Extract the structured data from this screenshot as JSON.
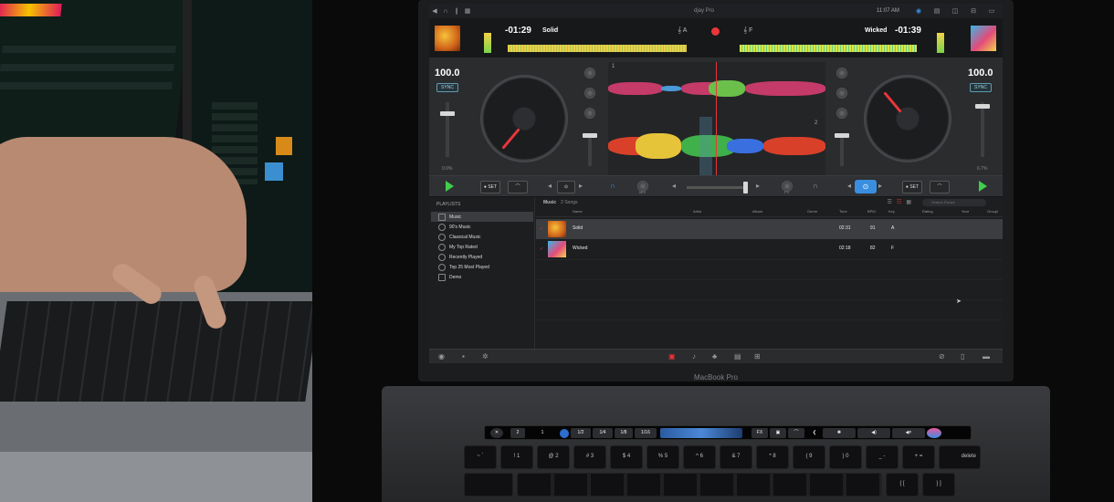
{
  "brand": {
    "laptop_model": "MacBook Pro",
    "app_logo": "djay Pro"
  },
  "menubar": {
    "time": "11:07 AM"
  },
  "deck_left": {
    "time": "-01:29",
    "title": "Solid",
    "key": "A",
    "bpm": "100.0",
    "sync_label": "SYNC",
    "pitch": "0.0%",
    "wave_num": "1"
  },
  "deck_right": {
    "time": "-01:39",
    "title": "Wicked",
    "key": "F",
    "bpm": "100.0",
    "sync_label": "SYNC",
    "pitch": "6.7%",
    "wave_num": "2"
  },
  "transport": {
    "set_label_left": "SET",
    "set_label_right": "SET",
    "label_mix": "MIX",
    "label_fx": "FX"
  },
  "library": {
    "sidebar_title": "PLAYLISTS",
    "playlists": [
      {
        "label": "Music",
        "icon": "music-library-icon",
        "selected": true
      },
      {
        "label": "90's Music",
        "icon": "playlist-icon",
        "selected": false
      },
      {
        "label": "Classical Music",
        "icon": "playlist-icon",
        "selected": false
      },
      {
        "label": "My Top Rated",
        "icon": "playlist-icon",
        "selected": false
      },
      {
        "label": "Recently Played",
        "icon": "playlist-icon",
        "selected": false
      },
      {
        "label": "Top 25 Most Played",
        "icon": "playlist-icon",
        "selected": false
      },
      {
        "label": "Demo",
        "icon": "playlist-folder-icon",
        "selected": false
      }
    ],
    "header_title": "Music",
    "header_count": "2 Songs",
    "search_placeholder": "Search iTunes",
    "columns": [
      "Name",
      "Artist",
      "Album",
      "Genre",
      "Time",
      "BPM",
      "Key",
      "Rating",
      "Year",
      "Groupi"
    ],
    "tracks": [
      {
        "name": "Solid",
        "artist": "",
        "album": "",
        "genre": "",
        "time": "02:31",
        "bpm": "91",
        "key": "A"
      },
      {
        "name": "Wicked",
        "artist": "",
        "album": "",
        "genre": "",
        "time": "02:18",
        "bpm": "82",
        "key": "F"
      }
    ]
  },
  "touchbar": {
    "loop_values": [
      "2",
      "1",
      "1/2",
      "1/4",
      "1/8",
      "1/16"
    ],
    "fx_label": "FX"
  },
  "keyboard": {
    "number_row": [
      "~",
      "!",
      "@",
      "#",
      "$",
      "%",
      "^",
      "&",
      "*",
      "(",
      ")",
      "_",
      "+",
      "delete"
    ],
    "number_row_sub": [
      "`",
      "1",
      "2",
      "3",
      "4",
      "5",
      "6",
      "7",
      "8",
      "9",
      "0",
      "-",
      "=",
      ""
    ]
  },
  "colors": {
    "accent_red": "#e8363a",
    "play_green": "#3fcf4a",
    "sync_blue": "#3a8ee0"
  }
}
